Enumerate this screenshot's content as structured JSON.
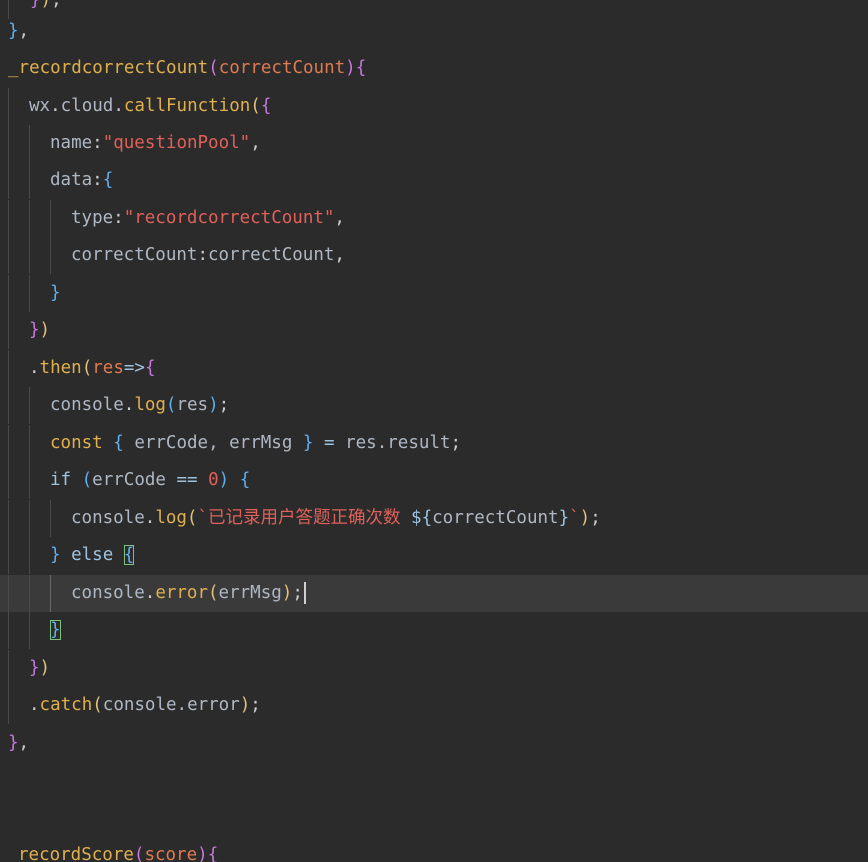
{
  "code": {
    "l1": {
      "fn": "_recordcorrectCount",
      "param": "correctCount"
    },
    "l2": {
      "obj": "wx",
      "prop": "cloud",
      "method": "callFunction"
    },
    "l3": {
      "key": "name",
      "value": "\"questionPool\""
    },
    "l4": {
      "key": "data"
    },
    "l5": {
      "key": "type",
      "value": "\"recordcorrectCount\""
    },
    "l6": {
      "key": "correctCount",
      "value": "correctCount"
    },
    "l9": {
      "method": "then",
      "param": "res"
    },
    "l10": {
      "obj": "console",
      "method": "log",
      "arg": "res"
    },
    "l11": {
      "kw": "const",
      "names": "errCode, errMsg",
      "rhs": "res.result"
    },
    "l12": {
      "kw": "if",
      "cond": "errCode",
      "op": "==",
      "num": "0"
    },
    "l13": {
      "obj": "console",
      "method": "log",
      "template_text": "`已记录用户答题正确次数 ",
      "template_var": "correctCount",
      "template_end": "`"
    },
    "l14": {
      "kw": "else"
    },
    "l15": {
      "obj": "console",
      "method": "error",
      "arg": "errMsg"
    },
    "l18": {
      "method": "catch",
      "arg": "console.error"
    },
    "l22": {
      "fn": "recordScore",
      "param": "score"
    }
  },
  "colors": {
    "background": "#2b2b2b",
    "current_line": "#3a3a3a",
    "function": "#e0b04e",
    "string": "#e0605a",
    "parameter": "#e07a52"
  }
}
